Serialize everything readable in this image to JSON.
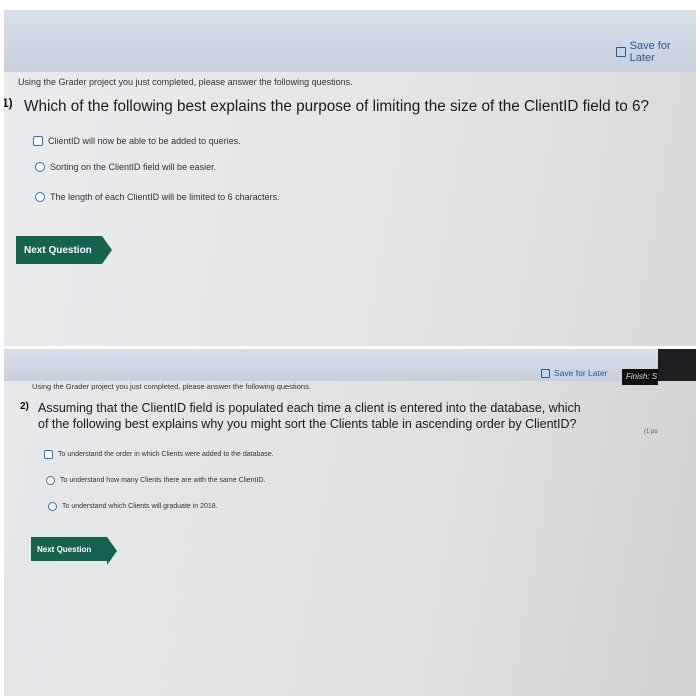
{
  "screen1": {
    "save_label": "Save for Later",
    "intro": "Using the Grader project you just completed, please answer the following questions.",
    "question_number": "1)",
    "question": "Which of the following best explains the purpose of limiting the size of the ClientID field to 6?",
    "options": [
      "ClientID will now be able to be added to queries.",
      "Sorting on the ClientID field will be easier.",
      "The length of each ClientID will be limited to 6 characters."
    ],
    "next_label": "Next Question"
  },
  "screen2": {
    "save_label": "Save for Later",
    "finish_label": "Finish: S",
    "points_label": "(1 po",
    "intro": "Using the Grader project you just completed, please answer the following questions.",
    "question_number": "2)",
    "question_line1": "Assuming that the ClientID field is populated each time a client is entered into the database, which",
    "question_line2": "of the following best explains why you might sort the Clients table in ascending order by ClientID?",
    "options": [
      "To understand the order in which Clients were added to the database.",
      "To understand how many Clients there are with the same ClientID.",
      "To understand which Clients will graduate in 2018."
    ],
    "next_label": "Next Question"
  },
  "icons": {
    "save": "save-icon",
    "radio": "radio-button",
    "checkbox": "checkbox"
  },
  "colors": {
    "link_blue": "#1d5a9b",
    "button_green": "#16614f",
    "radio_blue": "#2d72b8"
  }
}
